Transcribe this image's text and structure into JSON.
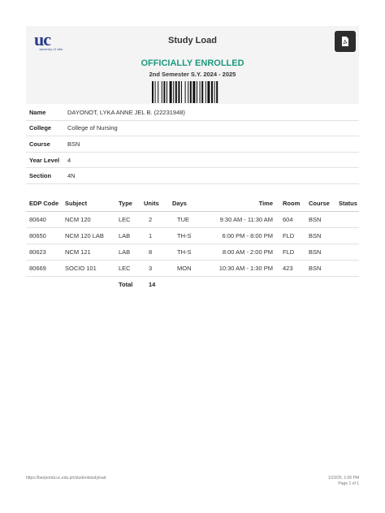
{
  "header": {
    "logo_mark": "uc",
    "logo_text": "university of cebu",
    "title": "Study Load",
    "pdf_icon": "pdf-file-icon"
  },
  "status": {
    "enrollment": "OFFICIALLY ENROLLED",
    "semester": "2nd Semester S.Y. 2024 - 2025"
  },
  "colors": {
    "accent_green": "#1b9a7e",
    "logo_blue": "#2b3e8c",
    "logo_gold": "#d9a91f"
  },
  "student": {
    "name_label": "Name",
    "name": "DAYONOT, LYKA ANNE JEL B. (22231948)",
    "college_label": "College",
    "college": "College of Nursing",
    "course_label": "Course",
    "course": "BSN",
    "year_label": "Year Level",
    "year": "4",
    "section_label": "Section",
    "section": "4N"
  },
  "schedule": {
    "headers": [
      "EDP Code",
      "Subject",
      "Type",
      "Units",
      "Days",
      "Time",
      "Room",
      "Course",
      "Status"
    ],
    "rows": [
      {
        "edp": "80640",
        "subject": "NCM 120",
        "type": "LEC",
        "units": "2",
        "days": "TUE",
        "time": "9:30 AM - 11:30 AM",
        "room": "604",
        "course": "BSN",
        "status": ""
      },
      {
        "edp": "80650",
        "subject": "NCM 120 LAB",
        "type": "LAB",
        "units": "1",
        "days": "TH-S",
        "time": "6:00 PM - 8:00 PM",
        "room": "FLD",
        "course": "BSN",
        "status": ""
      },
      {
        "edp": "80623",
        "subject": "NCM 121",
        "type": "LAB",
        "units": "8",
        "days": "TH-S",
        "time": "8:00 AM - 2:00 PM",
        "room": "FLD",
        "course": "BSN",
        "status": ""
      },
      {
        "edp": "80669",
        "subject": "SOCIO 101",
        "type": "LEC",
        "units": "3",
        "days": "MON",
        "time": "10:30 AM - 1:30 PM",
        "room": "423",
        "course": "BSN",
        "status": ""
      }
    ],
    "total_label": "Total",
    "total_units": "14"
  },
  "footer": {
    "url": "https://banportal.uc.edu.ph/studentstudyload",
    "datetime": "1/23/25, 1:06 PM",
    "page": "Page 1 of 1"
  }
}
